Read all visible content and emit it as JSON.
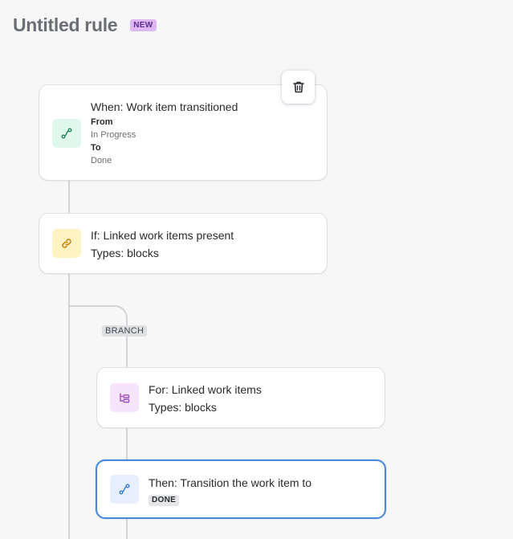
{
  "header": {
    "title": "Untitled rule",
    "badge": "NEW"
  },
  "trigger": {
    "title": "When: Work item transitioned",
    "from_label": "From",
    "from_value": "In Progress",
    "to_label": "To",
    "to_value": "Done",
    "icon": "transition-icon"
  },
  "condition": {
    "title": "If: Linked work items present",
    "types": "Types: blocks",
    "icon": "link-icon"
  },
  "branch": {
    "label": "BRANCH",
    "for_title": "For: Linked work items",
    "for_types": "Types: blocks",
    "for_icon": "branch-icon"
  },
  "action": {
    "title": "Then: Transition the work item to",
    "status": "DONE",
    "icon": "transition-icon"
  },
  "colors": {
    "accent": "#4b88d8",
    "badge_new": "#dcb8f5",
    "trigger_tile": "#dff7ec",
    "condition_tile": "#fff3c2",
    "branch_tile": "#f6e4fb",
    "action_tile": "#e6efff"
  }
}
